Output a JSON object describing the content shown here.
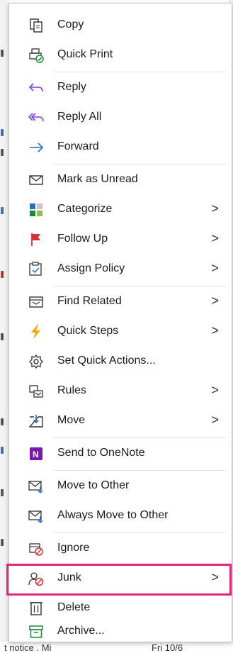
{
  "menu": {
    "items": [
      {
        "label": "Copy",
        "icon": "copy-icon",
        "submenu": false
      },
      {
        "label": "Quick Print",
        "icon": "quick-print-icon",
        "submenu": false
      },
      {
        "label": "Reply",
        "icon": "reply-icon",
        "submenu": false
      },
      {
        "label": "Reply All",
        "icon": "reply-all-icon",
        "submenu": false
      },
      {
        "label": "Forward",
        "icon": "forward-icon",
        "submenu": false
      },
      {
        "label": "Mark as Unread",
        "icon": "envelope-icon",
        "submenu": false
      },
      {
        "label": "Categorize",
        "icon": "categorize-icon",
        "submenu": true
      },
      {
        "label": "Follow Up",
        "icon": "flag-icon",
        "submenu": true
      },
      {
        "label": "Assign Policy",
        "icon": "policy-icon",
        "submenu": true
      },
      {
        "label": "Find Related",
        "icon": "find-related-icon",
        "submenu": true
      },
      {
        "label": "Quick Steps",
        "icon": "lightning-icon",
        "submenu": true
      },
      {
        "label": "Set Quick Actions...",
        "icon": "gear-icon",
        "submenu": false
      },
      {
        "label": "Rules",
        "icon": "rules-icon",
        "submenu": true
      },
      {
        "label": "Move",
        "icon": "move-icon",
        "submenu": true
      },
      {
        "label": "Send to OneNote",
        "icon": "onenote-icon",
        "submenu": false
      },
      {
        "label": "Move to Other",
        "icon": "move-to-other-icon",
        "submenu": false
      },
      {
        "label": "Always Move to Other",
        "icon": "always-move-icon",
        "submenu": false
      },
      {
        "label": "Ignore",
        "icon": "ignore-icon",
        "submenu": false
      },
      {
        "label": "Junk",
        "icon": "junk-icon",
        "submenu": true,
        "highlighted": true
      },
      {
        "label": "Delete",
        "icon": "trash-icon",
        "submenu": false
      },
      {
        "label": "Archive...",
        "icon": "archive-icon",
        "submenu": false
      }
    ],
    "submenu_glyph": ">"
  },
  "background": {
    "bottom_left_text": "t notice . Mi",
    "bottom_right_text": "Fri 10/6"
  },
  "colors": {
    "highlight_border": "#e2277c",
    "accent_blue": "#2b6cc4",
    "accent_purple": "#7b3fe4",
    "flag_red": "#d13438",
    "green": "#1a8a3a"
  }
}
